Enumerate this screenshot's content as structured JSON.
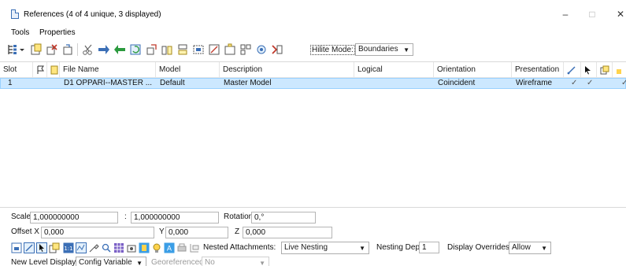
{
  "window": {
    "title": "References (4 of 4 unique, 3 displayed)",
    "minimize": "–",
    "maximize": "□",
    "close": "✕"
  },
  "menu": {
    "tools": "Tools",
    "properties": "Properties"
  },
  "toolbar": {
    "hilite_mode_label": "Hilite Mode:",
    "hilite_mode_value": "Boundaries"
  },
  "table": {
    "columns": {
      "slot": "Slot",
      "file_name": "File Name",
      "model": "Model",
      "description": "Description",
      "logical": "Logical",
      "orientation": "Orientation",
      "presentation": "Presentation"
    },
    "rows": [
      {
        "slot": "1",
        "file_name": "D1 OPPARI--MASTER ...",
        "model": "Default",
        "description": "Master Model",
        "logical": "",
        "orientation": "Coincident",
        "presentation": "Wireframe",
        "check1": "✓",
        "check2": "✓",
        "check3": "✓"
      }
    ]
  },
  "bottom": {
    "scale_label": "Scale",
    "scale_value": "1,000000000",
    "scale_sep": ":",
    "scale_value2": "1,000000000",
    "rotation_label": "Rotation",
    "rotation_value": "0,°",
    "offset_label": "Offset X",
    "offset_x": "0,000",
    "y_label": "Y",
    "offset_y": "0,000",
    "z_label": "Z",
    "offset_z": "0,000",
    "nested_label": "Nested Attachments:",
    "nested_value": "Live Nesting",
    "nesting_depth_label": "Nesting Depth:",
    "nesting_depth_value": "1",
    "display_overrides_label": "Display Overrides:",
    "display_overrides_value": "Allow",
    "new_level_label": "New Level Display:",
    "new_level_value": "Config Variable",
    "georeferenced_label": "Georeferenced:",
    "georeferenced_value": "No"
  },
  "colors": {
    "selection": "#cce8ff",
    "accent": "#3b6fb6"
  }
}
